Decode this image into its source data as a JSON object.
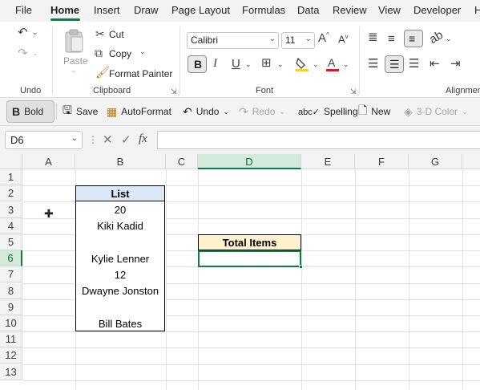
{
  "menu": [
    "File",
    "Home",
    "Insert",
    "Draw",
    "Page Layout",
    "Formulas",
    "Data",
    "Review",
    "View",
    "Developer",
    "H"
  ],
  "ribbon": {
    "undo_group": "Undo",
    "clipboard": {
      "label": "Clipboard",
      "paste": "Paste",
      "cut": "Cut",
      "copy": "Copy",
      "format_painter": "Format Painter"
    },
    "font": {
      "label": "Font",
      "name": "Calibri",
      "size": "11",
      "bold": "B",
      "italic": "I",
      "underline": "U"
    },
    "alignment": {
      "label": "Alignmen"
    }
  },
  "toolbar": {
    "bold": "Bold",
    "save": "Save",
    "autoformat": "AutoFormat",
    "undo": "Undo",
    "redo": "Redo",
    "spelling": "Spelling",
    "new": "New",
    "color3d": "3-D Color"
  },
  "formula_bar": {
    "name_box": "D6",
    "fx": "fx",
    "value": ""
  },
  "grid": {
    "columns": [
      "A",
      "B",
      "C",
      "D",
      "E",
      "F",
      "G"
    ],
    "rows": [
      "1",
      "2",
      "3",
      "4",
      "5",
      "6",
      "7",
      "8",
      "9",
      "10",
      "11",
      "12",
      "13"
    ],
    "active_cell": "D6",
    "list_header": "List",
    "list": [
      "20",
      "Kiki Kadid",
      "",
      "Kylie Lenner",
      "12",
      "Dwayne Jonston",
      "",
      "Bill Bates"
    ],
    "total_header": "Total Items",
    "total_value": ""
  },
  "colors": {
    "accent": "#107c41",
    "list_header_fill": "#dbe9f6",
    "total_header_fill": "#fff2cc"
  }
}
